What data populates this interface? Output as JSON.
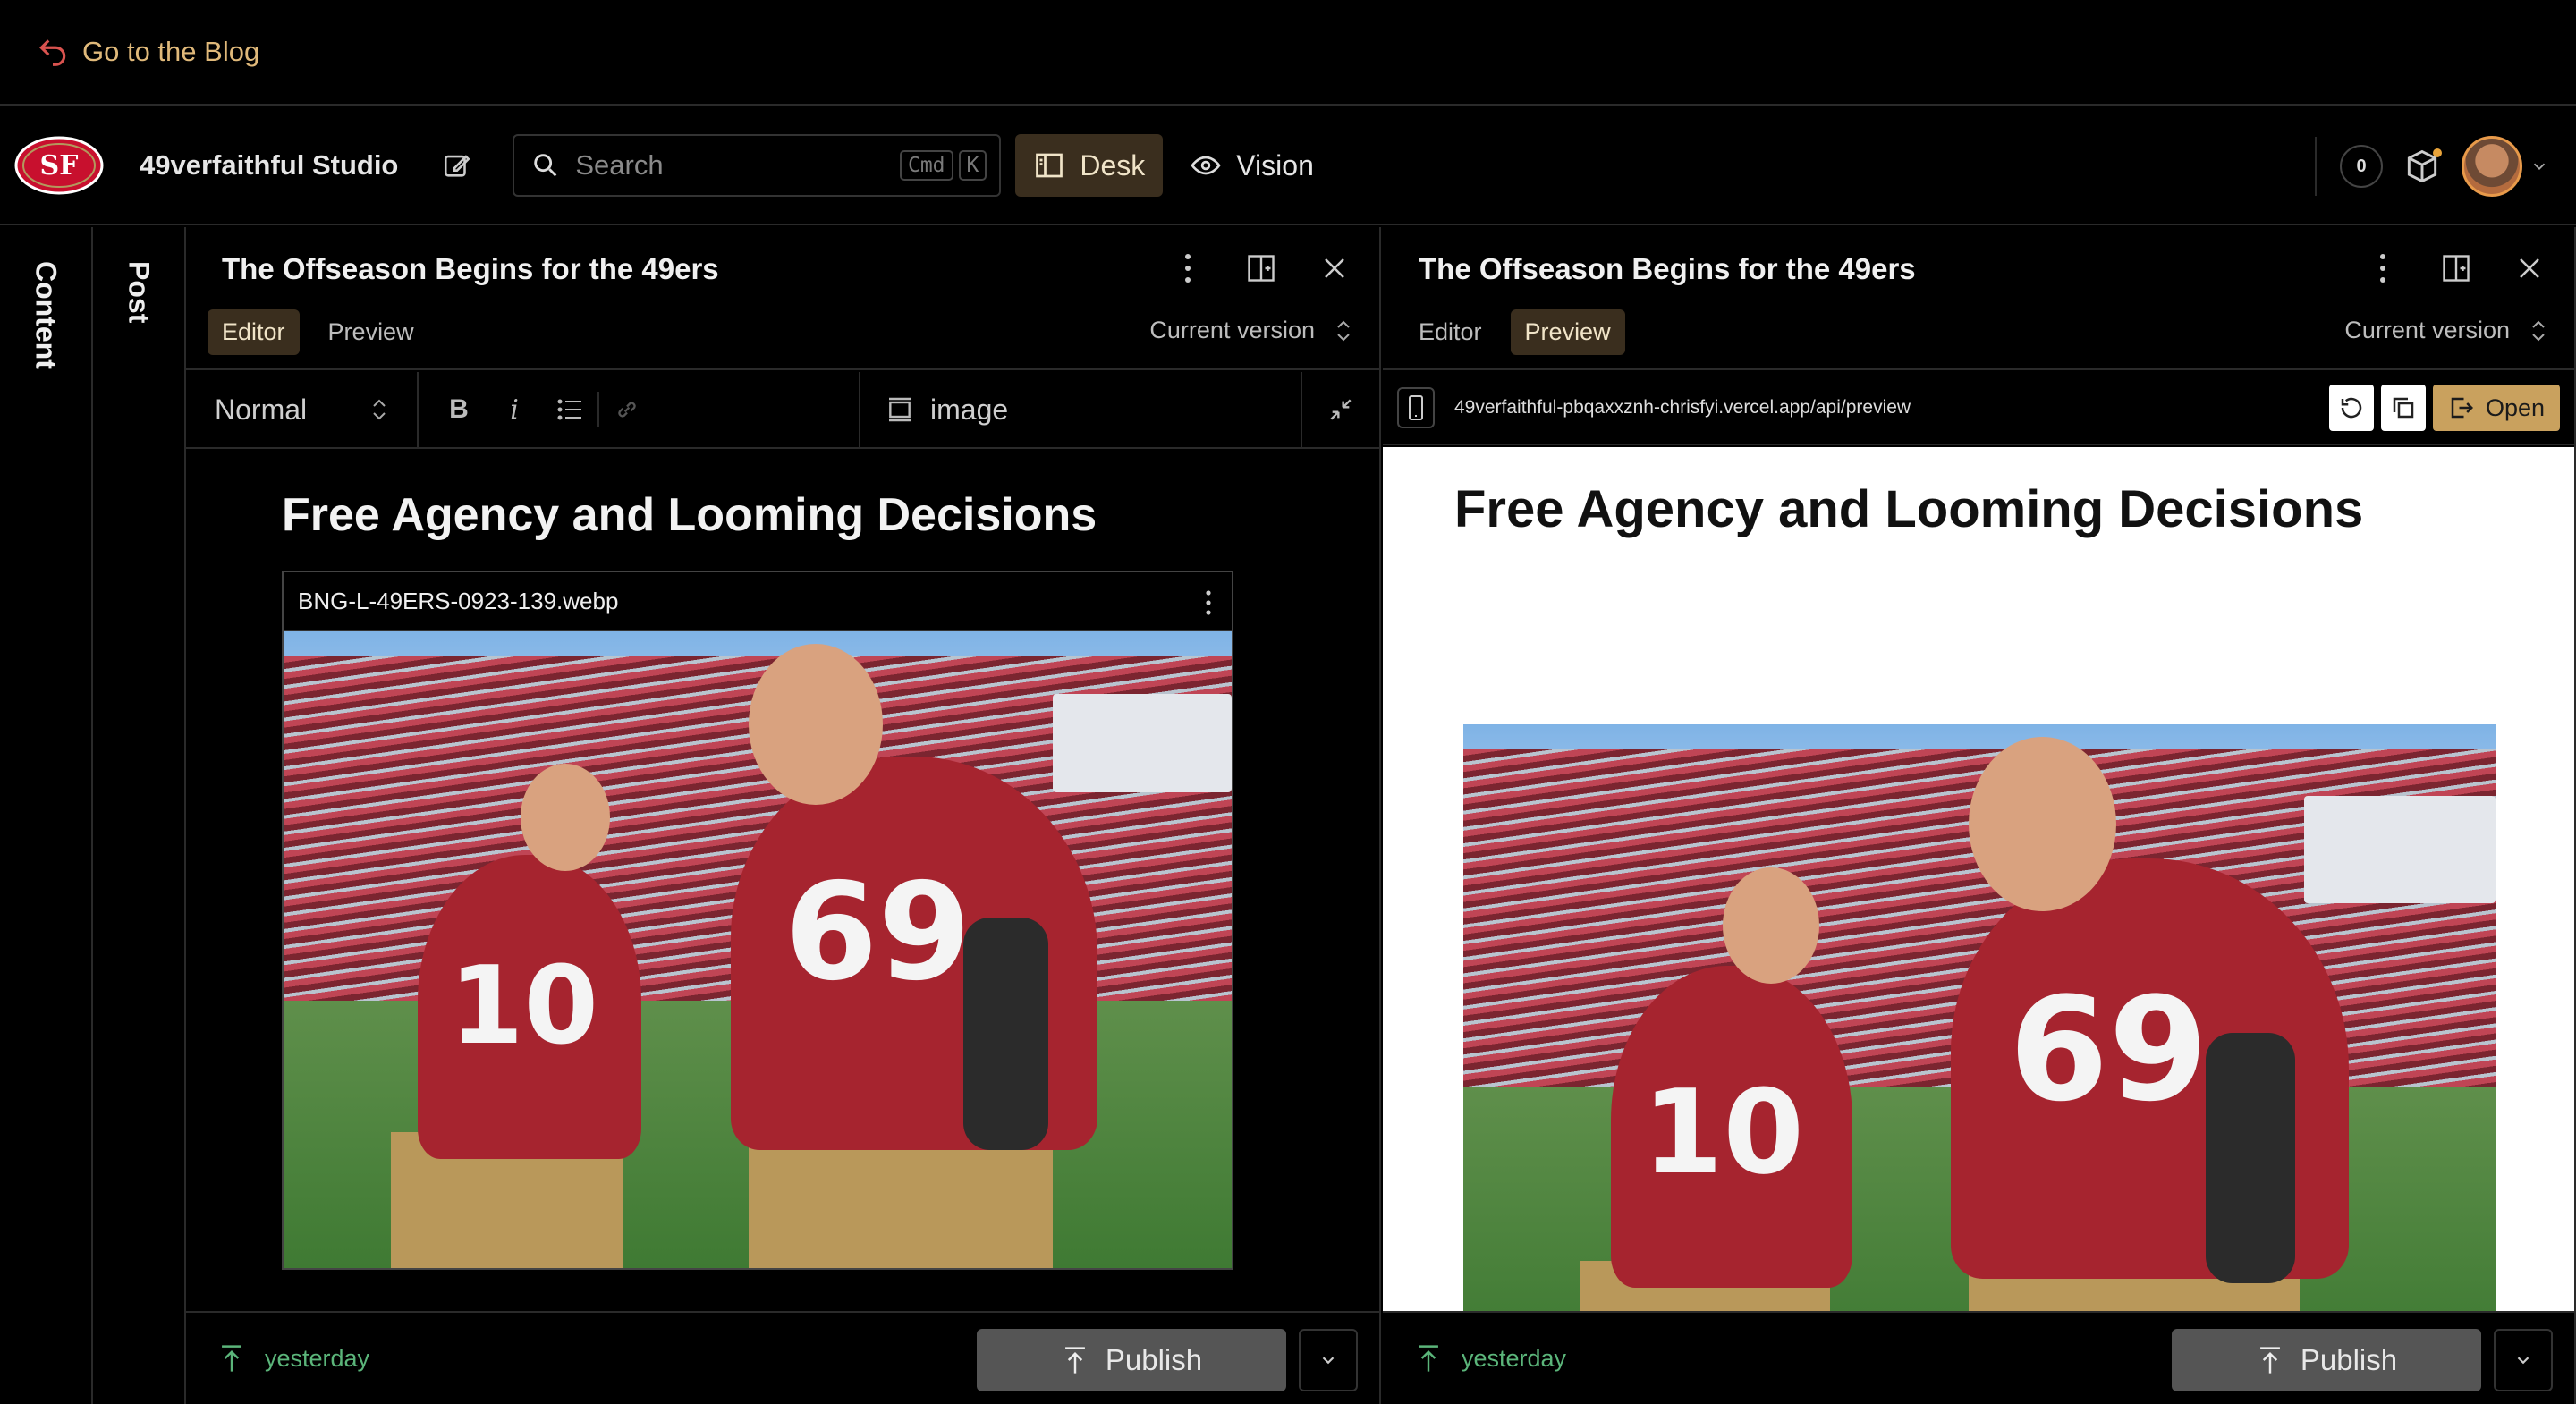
{
  "blogbar": {
    "back_label": "Go to the Blog"
  },
  "navbar": {
    "studio_title": "49verfaithful Studio",
    "search": {
      "placeholder": "Search",
      "kbd1": "Cmd",
      "kbd2": "K"
    },
    "desk_label": "Desk",
    "vision_label": "Vision",
    "notification_count": "0"
  },
  "strips": {
    "content_label": "Content",
    "post_label": "Post"
  },
  "left_pane": {
    "title": "The Offseason Begins for the 49ers",
    "tabs": [
      "Editor",
      "Preview"
    ],
    "active_tab": "Editor",
    "version_label": "Current version",
    "toolbar": {
      "style_value": "Normal",
      "bold": "B",
      "italic": "i",
      "insert_label": "image"
    },
    "body": {
      "heading": "Free Agency and Looming Decisions",
      "image_filename": "BNG-L-49ERS-0923-139.webp"
    },
    "footer": {
      "status": "yesterday",
      "publish_label": "Publish"
    }
  },
  "right_pane": {
    "title": "The Offseason Begins for the 49ers",
    "tabs": [
      "Editor",
      "Preview"
    ],
    "active_tab": "Preview",
    "version_label": "Current version",
    "url": "49verfaithful-pbqaxxznh-chrisfyi.vercel.app/api/preview",
    "open_label": "Open",
    "preview": {
      "heading": "Free Agency and Looming Decisions"
    },
    "footer": {
      "status": "yesterday",
      "publish_label": "Publish"
    }
  },
  "photo": {
    "number_left": "10",
    "number_right": "69"
  },
  "colors": {
    "accent": "#e0b97a",
    "active_bg": "#3a2e1e",
    "status_green": "#5bb57a",
    "open_btn": "#c9a15e"
  }
}
